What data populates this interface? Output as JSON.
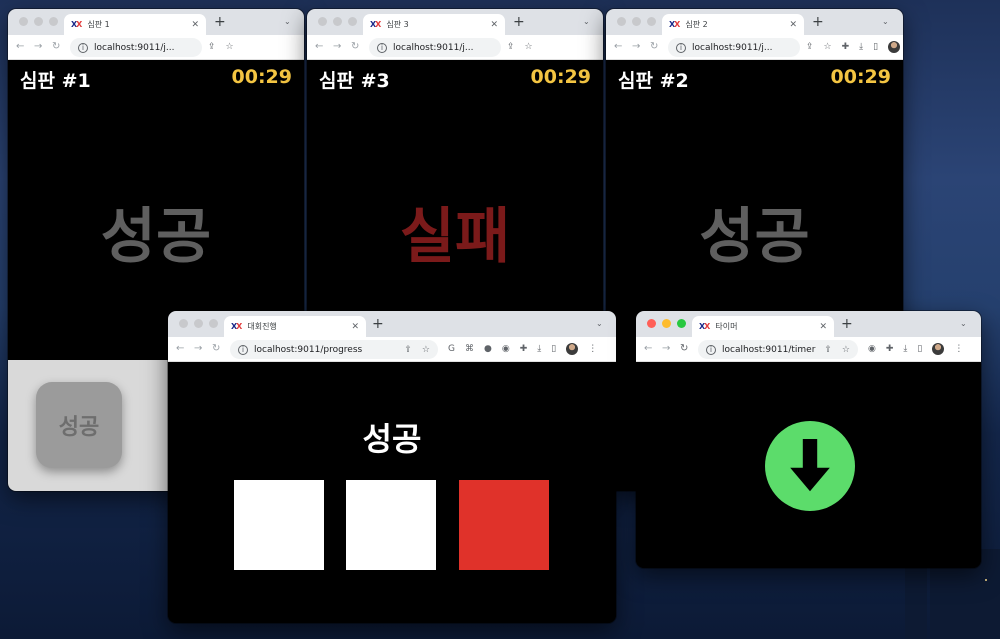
{
  "colors": {
    "timer": "#f4c542",
    "result_success": "#5f5f5f",
    "result_fail": "#7b1a1a",
    "judge_box_white": "#ffffff",
    "judge_box_red": "#e0322a",
    "timer_icon_green": "#5cdc6b"
  },
  "judges": [
    {
      "tab_title": "심판 1",
      "url": "localhost:9011/j...",
      "title": "심판 #1",
      "timer": "00:29",
      "result": "성공",
      "button_label": "성공"
    },
    {
      "tab_title": "심판 3",
      "url": "localhost:9011/j...",
      "title": "심판 #3",
      "timer": "00:29",
      "result": "실패"
    },
    {
      "tab_title": "심판 2",
      "url": "localhost:9011/j...",
      "title": "심판 #2",
      "timer": "00:29",
      "result": "성공"
    }
  ],
  "progress": {
    "tab_title": "대회진행",
    "url": "localhost:9011/progress",
    "status": "성공",
    "boxes": [
      "white",
      "white",
      "red"
    ]
  },
  "timer_window": {
    "tab_title": "타이머",
    "url": "localhost:9011/timer",
    "icon": "arrow-down-circle-icon"
  },
  "favicon": {
    "left": "X",
    "right": "X"
  }
}
